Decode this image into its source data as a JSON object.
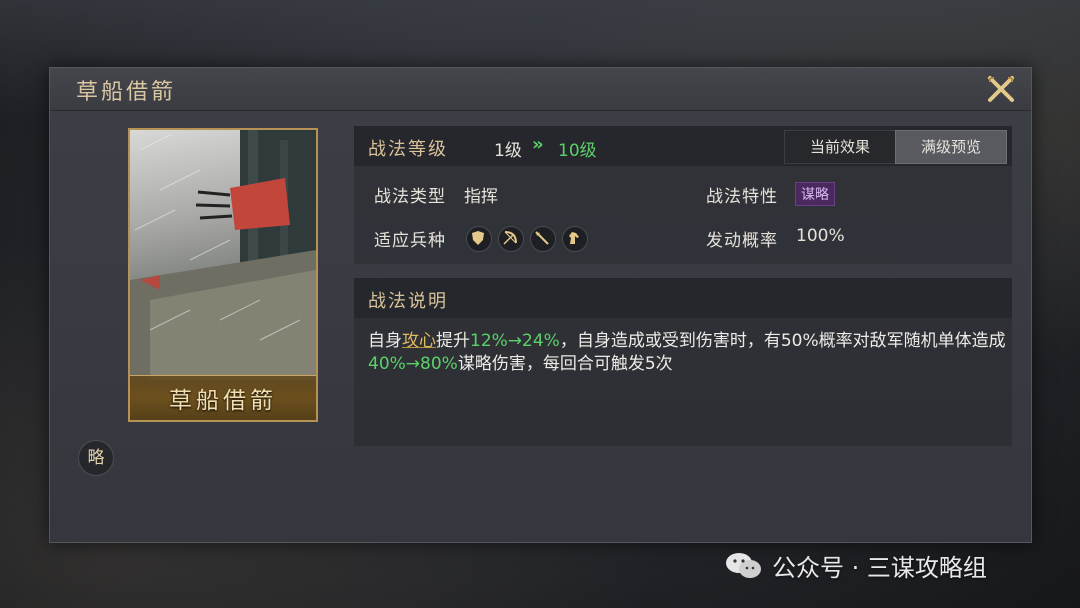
{
  "dialog": {
    "title": "草船借箭"
  },
  "card": {
    "name": "草船借箭",
    "type_badge": "略"
  },
  "level": {
    "label": "战法等级",
    "from": "1级",
    "to": "10级"
  },
  "tabs": [
    {
      "label": "当前效果",
      "selected": false
    },
    {
      "label": "满级预览",
      "selected": true
    }
  ],
  "info": {
    "type_label": "战法类型",
    "type_value": "指挥",
    "trait_label": "战法特性",
    "trait_value": "谋略",
    "troops_label": "适应兵种",
    "troop_icons": [
      "shield-icon",
      "bow-icon",
      "spear-icon",
      "horse-icon"
    ],
    "trigger_label": "发动概率",
    "trigger_value": "100%"
  },
  "description": {
    "title": "战法说明",
    "p1": "自身",
    "p2": "攻心",
    "p3": "提升",
    "p4": "12%→24%",
    "p5": "，自身造成或受到伤害时，有50%概率对敌军随机单体造成",
    "p6": "40%→80%",
    "p7": "谋略伤害，每回合可触发5次"
  },
  "watermark": {
    "text": "公众号 · 三谋攻略组"
  },
  "colors": {
    "gold_label": "#d9c29a",
    "green": "#5bd16a",
    "highlight_gold": "#e2b960",
    "trait_purple": "#4a2a5e"
  }
}
